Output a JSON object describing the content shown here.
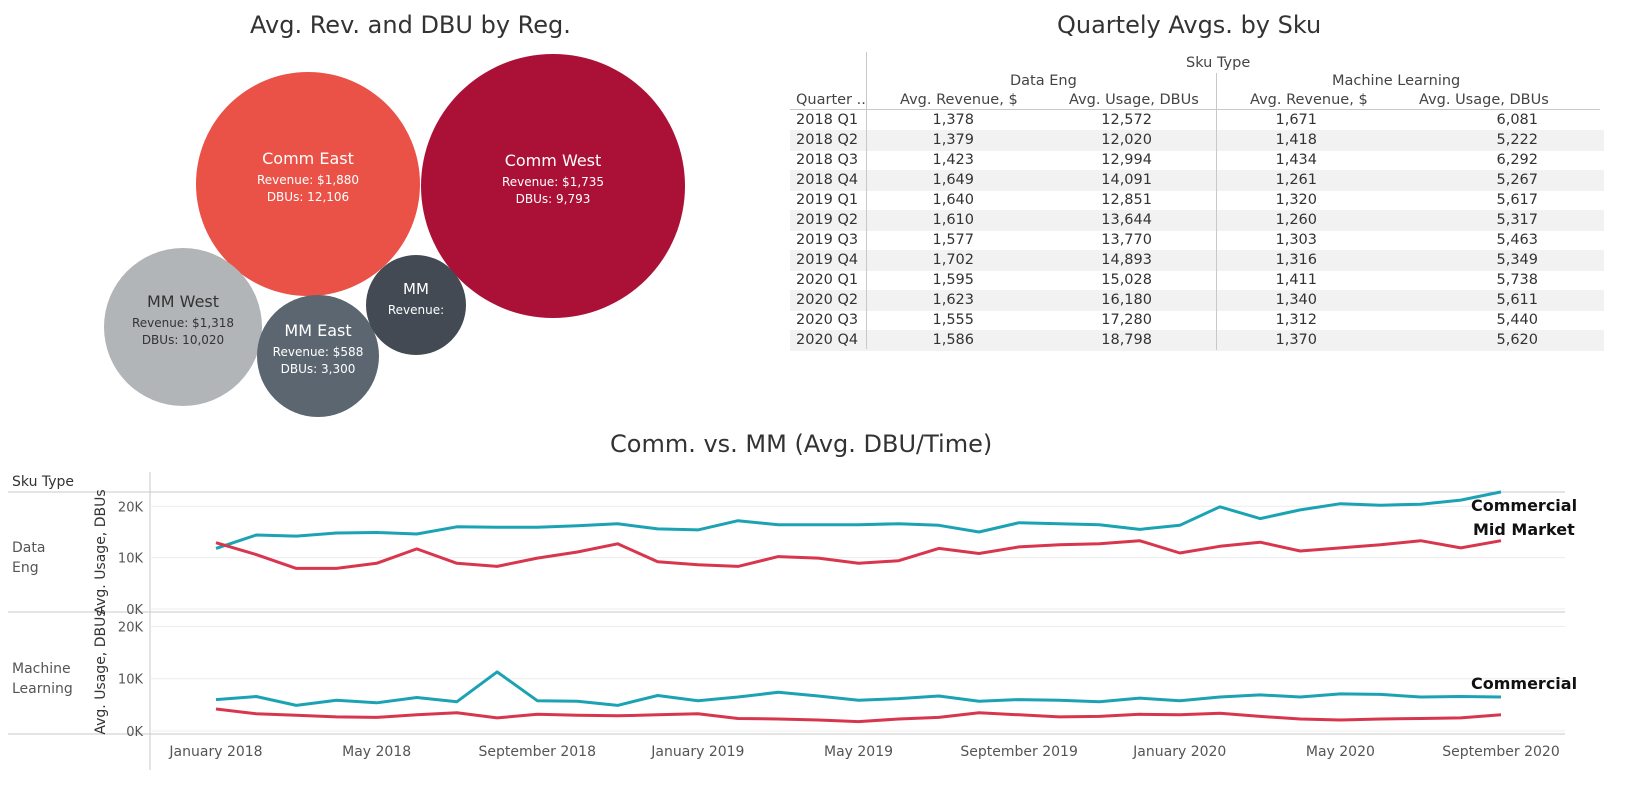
{
  "bubble_chart": {
    "title": "Avg. Rev. and DBU by Reg.",
    "bubbles": [
      {
        "name": "Comm East",
        "revenue_label": "Revenue: $1,880",
        "dbu_label": "DBUs: 12,106",
        "color": "#ea5248"
      },
      {
        "name": "Comm West",
        "revenue_label": "Revenue: $1,735",
        "dbu_label": "DBUs: 9,793",
        "color": "#ab1137"
      },
      {
        "name": "MM West",
        "revenue_label": "Revenue: $1,318",
        "dbu_label": "DBUs: 10,020",
        "color": "#b1b5b7"
      },
      {
        "name": "MM East",
        "revenue_label": "Revenue: $588",
        "dbu_label": "DBUs: 3,300",
        "color": "#5b6670"
      },
      {
        "name": "MM",
        "revenue_label": "Revenue:",
        "dbu_label": "",
        "color": "#434a54"
      }
    ]
  },
  "table": {
    "title": "Quartely Avgs. by Sku",
    "sku_type_label": "Sku Type",
    "groups": [
      "Data Eng",
      "Machine Learning"
    ],
    "quarter_header": "Quarter ..",
    "measure_headers": [
      "Avg. Revenue, $",
      "Avg. Usage, DBUs",
      "Avg. Revenue, $",
      "Avg. Usage, DBUs"
    ],
    "rows": [
      {
        "quarter": "2018 Q1",
        "values": [
          "1,378",
          "12,572",
          "1,671",
          "6,081"
        ]
      },
      {
        "quarter": "2018 Q2",
        "values": [
          "1,379",
          "12,020",
          "1,418",
          "5,222"
        ]
      },
      {
        "quarter": "2018 Q3",
        "values": [
          "1,423",
          "12,994",
          "1,434",
          "6,292"
        ]
      },
      {
        "quarter": "2018 Q4",
        "values": [
          "1,649",
          "14,091",
          "1,261",
          "5,267"
        ]
      },
      {
        "quarter": "2019 Q1",
        "values": [
          "1,640",
          "12,851",
          "1,320",
          "5,617"
        ]
      },
      {
        "quarter": "2019 Q2",
        "values": [
          "1,610",
          "13,644",
          "1,260",
          "5,317"
        ]
      },
      {
        "quarter": "2019 Q3",
        "values": [
          "1,577",
          "13,770",
          "1,303",
          "5,463"
        ]
      },
      {
        "quarter": "2019 Q4",
        "values": [
          "1,702",
          "14,893",
          "1,316",
          "5,349"
        ]
      },
      {
        "quarter": "2020 Q1",
        "values": [
          "1,595",
          "15,028",
          "1,411",
          "5,738"
        ]
      },
      {
        "quarter": "2020 Q2",
        "values": [
          "1,623",
          "16,180",
          "1,340",
          "5,611"
        ]
      },
      {
        "quarter": "2020 Q3",
        "values": [
          "1,555",
          "17,280",
          "1,312",
          "5,440"
        ]
      },
      {
        "quarter": "2020 Q4",
        "values": [
          "1,586",
          "18,798",
          "1,370",
          "5,620"
        ]
      }
    ]
  },
  "chart_data": {
    "type": "line",
    "title": "Comm. vs. MM (Avg. DBU/Time)",
    "row_header": "Sku Type",
    "ylabel": "Avg. Usage, DBUs",
    "ylim": [
      0,
      22000
    ],
    "yticks": [
      0,
      10000,
      20000
    ],
    "ytick_labels": [
      "0K",
      "10K",
      "20K"
    ],
    "xtick_labels": [
      "January 2018",
      "May 2018",
      "September 2018",
      "January 2019",
      "May 2019",
      "September 2019",
      "January 2020",
      "May 2020",
      "September 2020"
    ],
    "x": [
      "2018-01",
      "2018-02",
      "2018-03",
      "2018-04",
      "2018-05",
      "2018-06",
      "2018-07",
      "2018-08",
      "2018-09",
      "2018-10",
      "2018-11",
      "2018-12",
      "2019-01",
      "2019-02",
      "2019-03",
      "2019-04",
      "2019-05",
      "2019-06",
      "2019-07",
      "2019-08",
      "2019-09",
      "2019-10",
      "2019-11",
      "2019-12",
      "2020-01",
      "2020-02",
      "2020-03",
      "2020-04",
      "2020-05",
      "2020-06",
      "2020-07",
      "2020-08",
      "2020-09",
      "2020-10",
      "2020-11",
      "2020-12"
    ],
    "panels": [
      {
        "name": "Data Eng",
        "series": [
          {
            "name": "Commercial",
            "color": "#1ba3b3",
            "values": [
              11800,
              14400,
              14200,
              14800,
              14900,
              14600,
              16000,
              15900,
              15900,
              16200,
              16600,
              15600,
              15400,
              17200,
              16400,
              16400,
              16400,
              16600,
              16300,
              15000,
              16800,
              16600,
              16400,
              15500,
              16300,
              19900,
              17600,
              19300,
              20500,
              20200,
              20400,
              21200,
              22800
            ]
          },
          {
            "name": "Mid Market",
            "color": "#d8364d",
            "values": [
              12900,
              10600,
              7900,
              7900,
              8900,
              11700,
              8900,
              8300,
              9900,
              11100,
              12700,
              9200,
              8600,
              8300,
              10200,
              9900,
              8900,
              9400,
              11800,
              10800,
              12100,
              12500,
              12700,
              13300,
              10900,
              12200,
              13000,
              11300,
              11900,
              12500,
              13300,
              11900,
              13300
            ]
          }
        ],
        "labels": [
          "Commercial",
          "Mid Market"
        ]
      },
      {
        "name": "Machine Learning",
        "series": [
          {
            "name": "Commercial",
            "color": "#1ba3b3",
            "values": [
              6000,
              6600,
              4900,
              5900,
              5400,
              6400,
              5600,
              11300,
              5800,
              5700,
              4900,
              6800,
              5800,
              6500,
              7400,
              6700,
              5900,
              6200,
              6700,
              5700,
              6000,
              5900,
              5600,
              6300,
              5800,
              6500,
              6900,
              6500,
              7100,
              7000,
              6500,
              6600,
              6500
            ]
          },
          {
            "name": "Mid Market",
            "color": "#d8364d",
            "values": [
              4200,
              3300,
              3000,
              2700,
              2600,
              3100,
              3500,
              2500,
              3200,
              3000,
              2900,
              3100,
              3300,
              2400,
              2300,
              2100,
              1800,
              2300,
              2600,
              3500,
              3100,
              2700,
              2800,
              3200,
              3100,
              3400,
              2800,
              2300,
              2100,
              2300,
              2400,
              2500,
              3100
            ]
          }
        ],
        "labels": [
          "Commercial"
        ]
      }
    ]
  }
}
